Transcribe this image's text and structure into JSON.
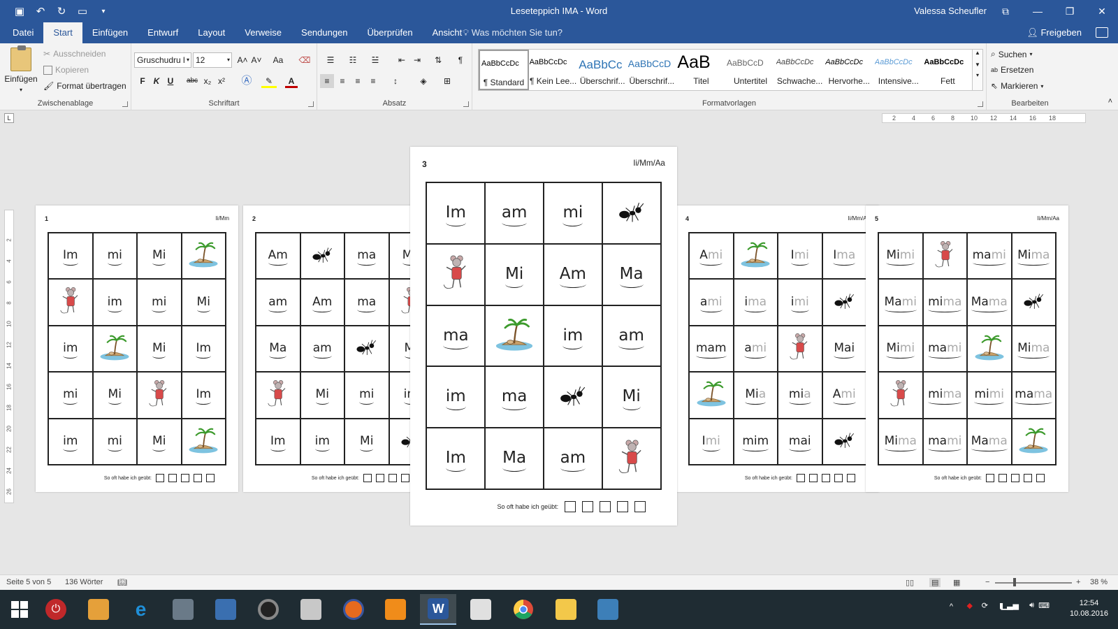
{
  "window": {
    "title": "Leseteppich IMA - Word",
    "user": "Valessa Scheufler",
    "controls": [
      "⧉",
      "—",
      "❐",
      "✕"
    ]
  },
  "menu": {
    "tabs": [
      "Datei",
      "Start",
      "Einfügen",
      "Entwurf",
      "Layout",
      "Verweise",
      "Sendungen",
      "Überprüfen",
      "Ansicht"
    ],
    "active": "Start",
    "tell_me": "Was möchten Sie tun?",
    "share": "Freigeben"
  },
  "ribbon": {
    "clipboard": {
      "paste": "Einfügen",
      "cut": "Ausschneiden",
      "copy": "Kopieren",
      "format_painter": "Format übertragen",
      "label": "Zwischenablage"
    },
    "font": {
      "family": "Gruschudru l",
      "size": "12",
      "label": "Schriftart",
      "buttons": {
        "bold": "F",
        "italic": "K",
        "underline": "U",
        "strike": "abc",
        "sub": "x₂",
        "sup": "x²",
        "grow": "A˄",
        "shrink": "A˅",
        "case": "Aa",
        "color": "A"
      }
    },
    "paragraph": {
      "label": "Absatz"
    },
    "styles": {
      "label": "Formatvorlagen",
      "items": [
        {
          "sample": "AaBbCcDc",
          "name": "¶ Standard"
        },
        {
          "sample": "AaBbCcDc",
          "name": "¶ Kein Lee..."
        },
        {
          "sample": "AaBbCc",
          "name": "Überschrif..."
        },
        {
          "sample": "AaBbCcD",
          "name": "Überschrif..."
        },
        {
          "sample": "AaB",
          "name": "Titel"
        },
        {
          "sample": "AaBbCcD",
          "name": "Untertitel"
        },
        {
          "sample": "AaBbCcDc",
          "name": "Schwache..."
        },
        {
          "sample": "AaBbCcDc",
          "name": "Hervorhe..."
        },
        {
          "sample": "AaBbCcDc",
          "name": "Intensive..."
        },
        {
          "sample": "AaBbCcDc",
          "name": "Fett"
        }
      ]
    },
    "editing": {
      "label": "Bearbeiten",
      "find": "Suchen",
      "replace": "Ersetzen",
      "select": "Markieren"
    }
  },
  "ruler": {
    "corner": "L",
    "h_ticks": [
      "2",
      "4",
      "6",
      "8",
      "10",
      "12",
      "14",
      "16",
      "18"
    ],
    "v_ticks": [
      "2",
      "4",
      "6",
      "8",
      "10",
      "12",
      "14",
      "16",
      "18",
      "20",
      "22",
      "24",
      "26"
    ]
  },
  "pages": [
    {
      "number": "1",
      "code": "Ii/Mm",
      "cells": [
        [
          {
            "t": "Im"
          },
          {
            "t": "mi"
          },
          {
            "t": "Mi"
          },
          {
            "pic": "island"
          }
        ],
        [
          {
            "pic": "mouse"
          },
          {
            "t": "im"
          },
          {
            "t": "mi"
          },
          {
            "t": "Mi"
          }
        ],
        [
          {
            "t": "im"
          },
          {
            "pic": "island"
          },
          {
            "t": "Mi"
          },
          {
            "t": "Im"
          }
        ],
        [
          {
            "t": "mi"
          },
          {
            "t": "Mi"
          },
          {
            "pic": "mouse"
          },
          {
            "t": "Im"
          }
        ],
        [
          {
            "t": "im"
          },
          {
            "t": "mi"
          },
          {
            "t": "Mi"
          },
          {
            "pic": "island"
          }
        ]
      ],
      "counter": "So oft habe ich geübt:"
    },
    {
      "number": "2",
      "code": "",
      "cells": [
        [
          {
            "t": "Am"
          },
          {
            "pic": "ant"
          },
          {
            "t": "ma"
          },
          {
            "t": "Ma"
          }
        ],
        [
          {
            "t": "am"
          },
          {
            "t": "Am"
          },
          {
            "t": "ma"
          },
          {
            "pic": "mouse"
          }
        ],
        [
          {
            "t": "Ma"
          },
          {
            "t": "am"
          },
          {
            "pic": "ant"
          },
          {
            "t": "Mi"
          }
        ],
        [
          {
            "pic": "mouse"
          },
          {
            "t": "Mi"
          },
          {
            "t": "mi"
          },
          {
            "t": "im"
          }
        ],
        [
          {
            "t": "Im"
          },
          {
            "t": "im"
          },
          {
            "t": "Mi"
          },
          {
            "pic": "ant"
          }
        ]
      ],
      "counter": "So oft habe ich geübt:"
    },
    {
      "number": "3",
      "code": "Ii/Mm/Aa",
      "cells": [
        [
          {
            "t": "Im"
          },
          {
            "t": "am"
          },
          {
            "t": "mi"
          },
          {
            "pic": "ant"
          }
        ],
        [
          {
            "pic": "mouse"
          },
          {
            "t": "Mi"
          },
          {
            "t": "Am"
          },
          {
            "t": "Ma"
          }
        ],
        [
          {
            "t": "ma"
          },
          {
            "pic": "island"
          },
          {
            "t": "im"
          },
          {
            "t": "am"
          }
        ],
        [
          {
            "t": "im"
          },
          {
            "t": "ma"
          },
          {
            "pic": "ant"
          },
          {
            "t": "Mi"
          }
        ],
        [
          {
            "t": "Im"
          },
          {
            "t": "Ma"
          },
          {
            "t": "am"
          },
          {
            "pic": "mouse"
          }
        ]
      ],
      "counter": "So oft habe ich geübt:"
    },
    {
      "number": "4",
      "code": "Ii/Mm/Aa",
      "cells": [
        [
          {
            "t": "A",
            "f": "mi"
          },
          {
            "pic": "island"
          },
          {
            "t": "I",
            "f": "mi"
          },
          {
            "t": "I",
            "f": "ma"
          }
        ],
        [
          {
            "t": "a",
            "f": "mi"
          },
          {
            "t": "i",
            "f": "ma"
          },
          {
            "t": "i",
            "f": "mi"
          },
          {
            "pic": "ant"
          }
        ],
        [
          {
            "t": "mam"
          },
          {
            "t": "a",
            "f": "mi"
          },
          {
            "pic": "mouse"
          },
          {
            "t": "Mai"
          }
        ],
        [
          {
            "pic": "island"
          },
          {
            "t": "Mi",
            "f": "a"
          },
          {
            "t": "mi",
            "f": "a"
          },
          {
            "t": "A",
            "f": "mi"
          }
        ],
        [
          {
            "t": "I",
            "f": "mi"
          },
          {
            "t": "mim"
          },
          {
            "t": "mai"
          },
          {
            "pic": "ant"
          }
        ]
      ],
      "counter": "So oft habe ich geübt:"
    },
    {
      "number": "5",
      "code": "Ii/Mm/Aa",
      "cells": [
        [
          {
            "t": "Mi",
            "f": "mi"
          },
          {
            "pic": "mouse"
          },
          {
            "t": "ma",
            "f": "mi"
          },
          {
            "t": "Mi",
            "f": "ma"
          }
        ],
        [
          {
            "t": "Ma",
            "f": "mi"
          },
          {
            "t": "mi",
            "f": "ma"
          },
          {
            "t": "Ma",
            "f": "ma"
          },
          {
            "pic": "ant"
          }
        ],
        [
          {
            "t": "Mi",
            "f": "mi"
          },
          {
            "t": "ma",
            "f": "mi"
          },
          {
            "pic": "island"
          },
          {
            "t": "Mi",
            "f": "ma"
          }
        ],
        [
          {
            "pic": "mouse"
          },
          {
            "t": "mi",
            "f": "ma"
          },
          {
            "t": "mi",
            "f": "mi"
          },
          {
            "t": "ma",
            "f": "ma"
          }
        ],
        [
          {
            "t": "Mi",
            "f": "ma"
          },
          {
            "t": "ma",
            "f": "mi"
          },
          {
            "t": "Ma",
            "f": "ma"
          },
          {
            "pic": "island"
          }
        ]
      ],
      "counter": "So oft habe ich geübt:"
    }
  ],
  "status": {
    "page": "Seite 5 von 5",
    "words": "136 Wörter",
    "zoom": "38 %",
    "zoom_minus": "−",
    "zoom_plus": "+"
  },
  "taskbar": {
    "apps": [
      "windows-logo",
      "power",
      "vlc",
      "internet-explorer",
      "doc-scanner",
      "calculator",
      "speaker",
      "paint",
      "firefox",
      "mail",
      "word",
      "acrobat",
      "chrome",
      "file-explorer",
      "photos"
    ],
    "time": "12:54",
    "date": "10.08.2016",
    "tray_arrow": "^"
  },
  "colors": {
    "word_blue": "#2b579a",
    "ribbon_bg": "#f3f3f3",
    "canvas": "#e6e6e6",
    "taskbar": "#1f2c33",
    "faded_syllable": "#aaaaaa"
  }
}
